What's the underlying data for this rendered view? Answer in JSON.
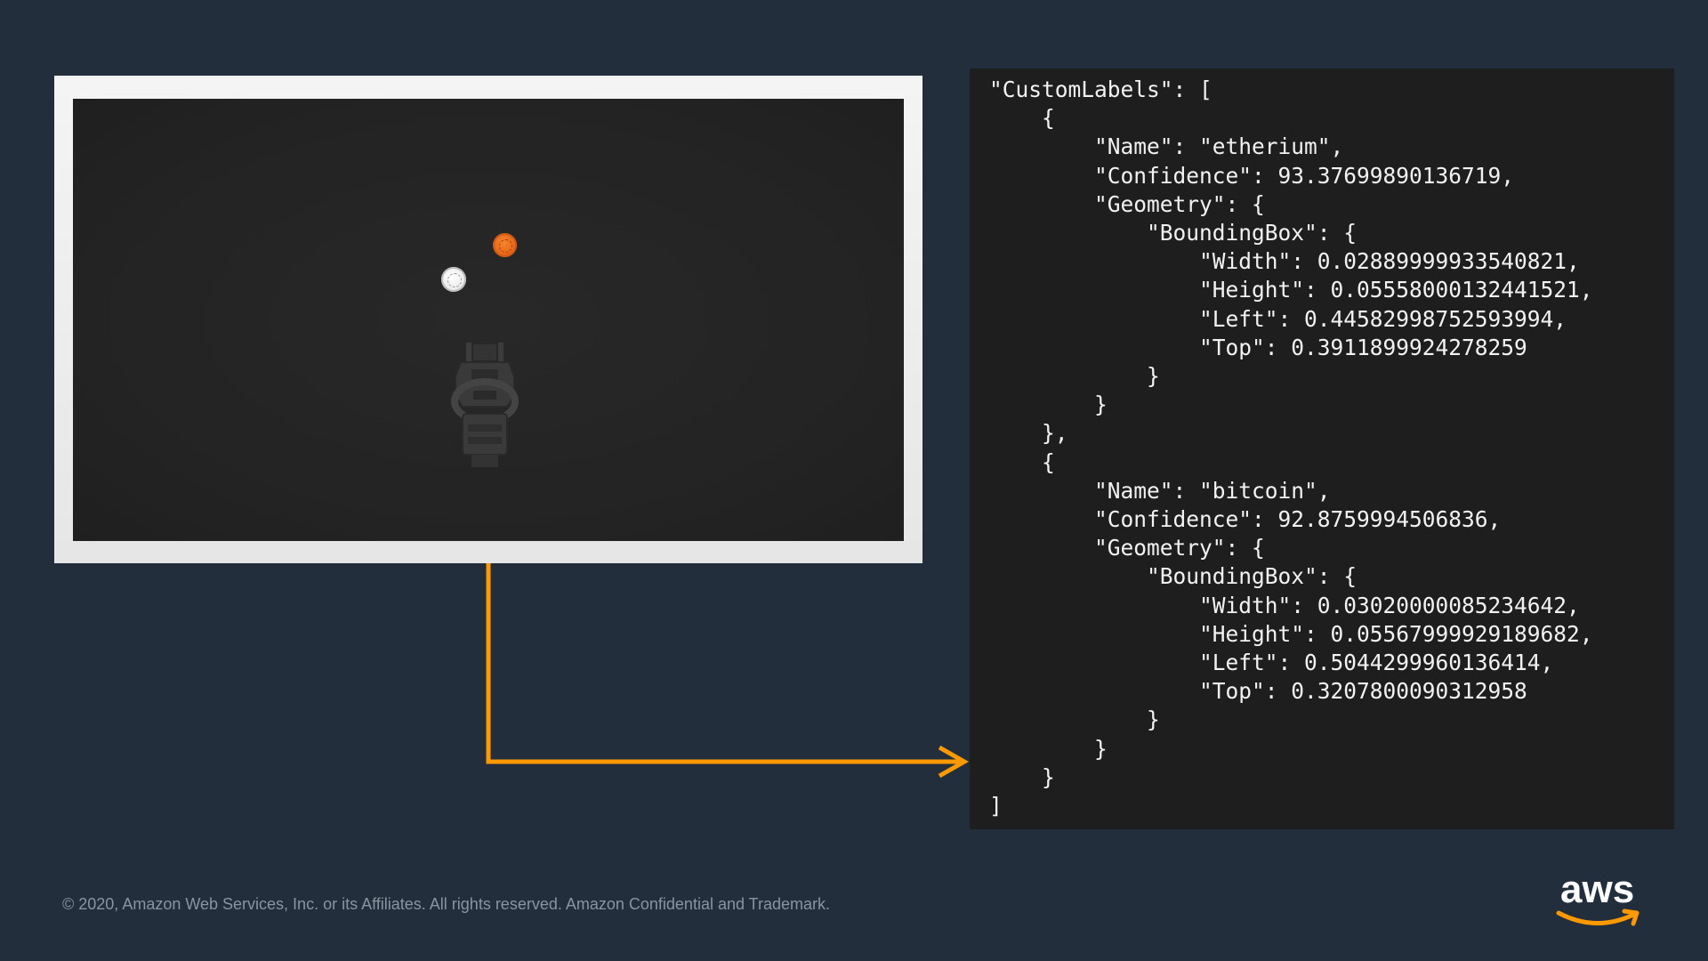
{
  "slide": {
    "json_output": "\"CustomLabels\": [\n    {\n        \"Name\": \"etherium\",\n        \"Confidence\": 93.37699890136719,\n        \"Geometry\": {\n            \"BoundingBox\": {\n                \"Width\": 0.02889999933540821,\n                \"Height\": 0.05558000132441521,\n                \"Left\": 0.44582998752593994,\n                \"Top\": 0.3911899924278259\n            }\n        }\n    },\n    {\n        \"Name\": \"bitcoin\",\n        \"Confidence\": 92.8759994506836,\n        \"Geometry\": {\n            \"BoundingBox\": {\n                \"Width\": 0.03020000085234642,\n                \"Height\": 0.05567999929189682,\n                \"Left\": 0.5044299960136414,\n                \"Top\": 0.3207800090312958\n            }\n        }\n    }\n]",
    "footer": "© 2020, Amazon Web Services, Inc. or its Affiliates. All rights reserved. Amazon Confidential and Trademark.",
    "logo_text": "aws"
  },
  "colors": {
    "background": "#222e3c",
    "arrow": "#ff9900",
    "coin_bitcoin": "#e8661b",
    "coin_etherium": "#ffffff",
    "json_panel": "#1e1e1e"
  },
  "icons": {
    "coin_bitcoin": "orange-coin-icon",
    "coin_etherium": "white-coin-icon",
    "robot": "robot-car-icon",
    "arrow": "arrow-right-icon",
    "logo": "aws-logo-icon"
  }
}
